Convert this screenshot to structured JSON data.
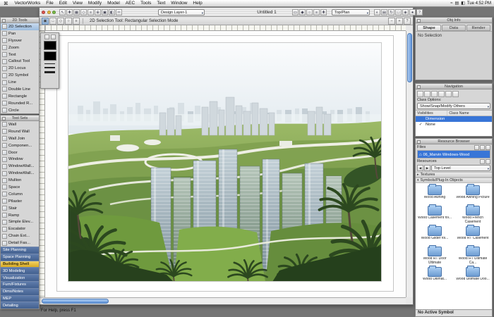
{
  "menu_bar": {
    "apple_glyph": "⌘",
    "items": [
      "VectorWorks",
      "File",
      "Edit",
      "View",
      "Modify",
      "Model",
      "AEC",
      "Tools",
      "Text",
      "Window",
      "Help"
    ],
    "status_icons": [
      "≈",
      "▤",
      "◧"
    ],
    "time": "Tue 4:52 PM"
  },
  "window": {
    "title": "Untitled 1"
  },
  "view_bar": {
    "layer_value": "Design Layer-1",
    "view_value": "Top/Plan",
    "icons_left": [
      "↖",
      "✚",
      "▦",
      "◇",
      "≡",
      "⊕",
      "▣",
      "◧",
      "═"
    ],
    "icons_mid": [
      "▭",
      "◆",
      "○",
      "≡",
      "✚"
    ],
    "icons_right": [
      "◐",
      "▤",
      "↻",
      "□",
      "◈",
      "●",
      "?"
    ]
  },
  "mode_bar": {
    "icons": [
      {
        "glyph": "▣",
        "active": true
      },
      {
        "glyph": "□"
      },
      {
        "glyph": "◇"
      },
      {
        "glyph": "○"
      },
      {
        "glyph": "≡"
      }
    ],
    "text": "2D Selection Tool: Rectangular Selection Mode"
  },
  "basic_palette": {
    "title": "2D Tools",
    "items": [
      {
        "label": "2D Selection",
        "active": true
      },
      {
        "label": "Pan"
      },
      {
        "label": "Flyover"
      },
      {
        "label": "Zoom"
      },
      {
        "label": "Text"
      },
      {
        "label": "Callout Tool"
      },
      {
        "label": "2D Locus"
      },
      {
        "label": "2D Symbol"
      },
      {
        "label": "Line"
      },
      {
        "label": "Double Line"
      },
      {
        "label": "Rectangle"
      },
      {
        "label": "Rounded R..."
      },
      {
        "label": "Circle"
      }
    ]
  },
  "attributes": {
    "fill_color": "#000000",
    "pen_color": "#000000"
  },
  "tool_sets": {
    "title": "Tool Sets",
    "tools": [
      {
        "label": "Wall"
      },
      {
        "label": "Round Wall"
      },
      {
        "label": "Wall Join"
      },
      {
        "label": "Componen..."
      },
      {
        "label": "Door"
      },
      {
        "label": "Window"
      },
      {
        "label": "WindowWall..."
      },
      {
        "label": "WindowWall..."
      },
      {
        "label": "Mullion"
      },
      {
        "label": "Space"
      },
      {
        "label": "Column"
      },
      {
        "label": "Pilaster"
      },
      {
        "label": "Stair"
      },
      {
        "label": "Ramp"
      },
      {
        "label": "Simple Elev..."
      },
      {
        "label": "Escalator"
      },
      {
        "label": "Chain Ext..."
      },
      {
        "label": "Detail Fas..."
      }
    ],
    "categories": [
      {
        "label": "Site Planning"
      },
      {
        "label": "Space Planning"
      },
      {
        "label": "Building Shell",
        "active": true
      },
      {
        "label": "3D Modeling"
      },
      {
        "label": "Visualization"
      },
      {
        "label": "Furn/Fixtures"
      },
      {
        "label": "Dims/Notes"
      },
      {
        "label": "MEP"
      },
      {
        "label": "Detailing"
      }
    ]
  },
  "obj_info": {
    "title": "Obj Info",
    "tabs": [
      {
        "label": "Shape",
        "active": true
      },
      {
        "label": "Data"
      },
      {
        "label": "Render"
      }
    ],
    "empty_text": "No Selection"
  },
  "navigation": {
    "title": "Navigation",
    "class_options_label": "Class Options:",
    "class_options_value": "Show/Snap/Modify Others",
    "columns": [
      "Visibilities",
      "Class Name"
    ],
    "rows": [
      {
        "name": "Dimension",
        "selected": true
      },
      {
        "name": "None",
        "checked": true
      }
    ]
  },
  "resource_browser": {
    "title": "Resource Browser",
    "files_label": "Files",
    "file_item": "06_Marvin Windows-Wood",
    "resources_label": "Resources",
    "level_value": "Top Level",
    "sections": [
      {
        "label": "Textures"
      },
      {
        "label": "Symbols/Plug-In Objects",
        "expanded": true
      }
    ],
    "folders": [
      {
        "label": "Wood Awning"
      },
      {
        "label": "Wood Awning Picture"
      },
      {
        "label": "Wood Casement fol..."
      },
      {
        "label": "Wood French Casement"
      },
      {
        "label": "Wood Glider fol..."
      },
      {
        "label": "Wood RT Casement"
      },
      {
        "label": "Wood RT Door Ultimate"
      },
      {
        "label": "Wood RT Ultimate Ca..."
      },
      {
        "label": "Wood Ultimat..."
      },
      {
        "label": "Wood Ultimate Doo..."
      }
    ],
    "footer": "No Active Symbol"
  },
  "help_text": "For Help, press F1",
  "colors": {
    "selection_blue": "#3875d7",
    "category_blue": "#42608f",
    "category_active_yellow": "#d8ab22",
    "aqua_scrollbar": "#5e92d9"
  }
}
